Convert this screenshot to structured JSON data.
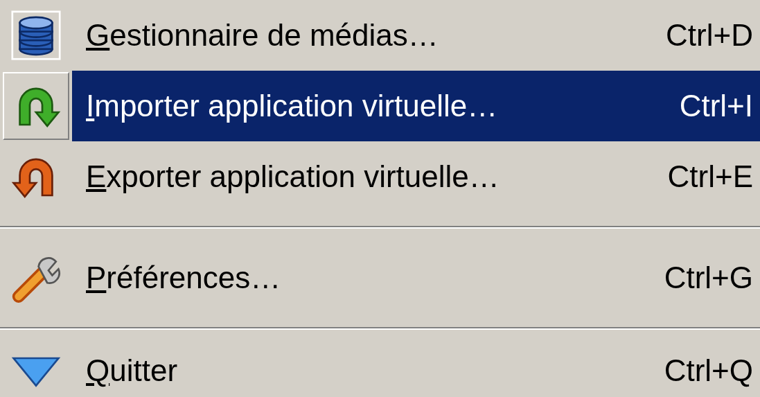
{
  "menu": {
    "items": [
      {
        "kind": "item",
        "label": "Gestionnaire de médias…",
        "shortcut": "Ctrl+D",
        "underline_first": true,
        "selected": false
      },
      {
        "kind": "item",
        "label": "Importer application virtuelle…",
        "shortcut": "Ctrl+I",
        "underline_first": true,
        "selected": true
      },
      {
        "kind": "item",
        "label": "Exporter application virtuelle…",
        "shortcut": "Ctrl+E",
        "underline_first": true,
        "selected": false
      },
      {
        "kind": "separator"
      },
      {
        "kind": "item",
        "label": "Préférences…",
        "shortcut": "Ctrl+G",
        "underline_first": true,
        "selected": false
      },
      {
        "kind": "separator"
      },
      {
        "kind": "item",
        "label": "Quitter",
        "shortcut": "Ctrl+Q",
        "underline_first": true,
        "selected": false
      }
    ]
  }
}
